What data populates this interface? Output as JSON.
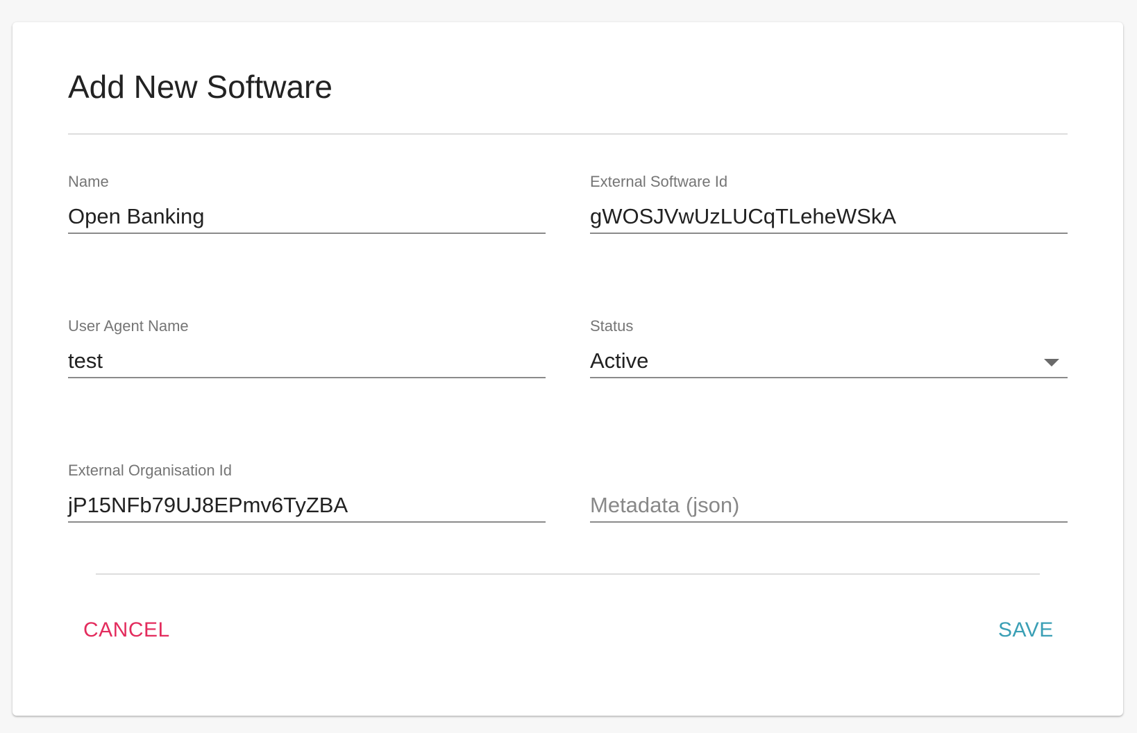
{
  "dialog": {
    "title": "Add New Software"
  },
  "fields": {
    "name": {
      "label": "Name",
      "value": "Open Banking"
    },
    "external_software_id": {
      "label": "External Software Id",
      "value": "gWOSJVwUzLUCqTLeheWSkA"
    },
    "user_agent_name": {
      "label": "User Agent Name",
      "value": "test"
    },
    "status": {
      "label": "Status",
      "value": "Active"
    },
    "external_organisation_id": {
      "label": "External Organisation Id",
      "value": "jP15NFb79UJ8EPmv6TyZBA"
    },
    "metadata": {
      "placeholder": "Metadata (json)",
      "value": ""
    }
  },
  "actions": {
    "cancel_label": "CANCEL",
    "save_label": "SAVE"
  },
  "colors": {
    "cancel": "#e32c5d",
    "save": "#3a9fb5",
    "underline": "#8a8a8a"
  },
  "icons": {
    "status_dropdown": "caret-down-icon"
  }
}
